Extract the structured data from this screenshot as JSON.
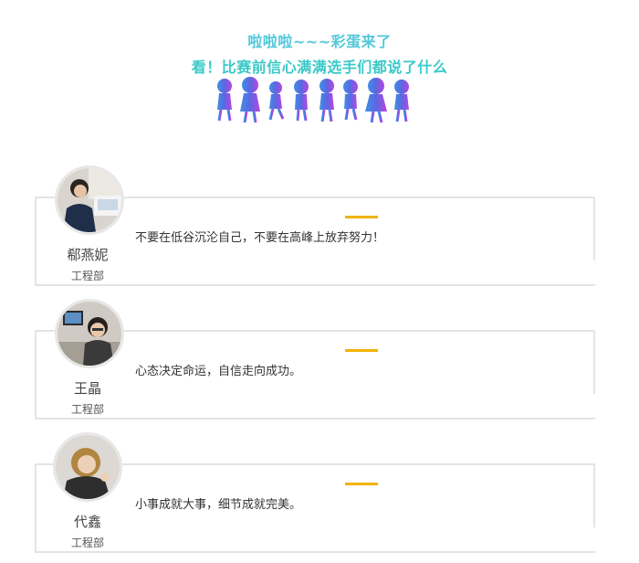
{
  "header": {
    "line1": "啦啦啦~~~彩蛋来了",
    "line2": "看！比赛前信心满满选手们都说了什么",
    "line1_color": "#53c7d9",
    "line2_color": "#3ac9c9",
    "decoration": "children-holding-hands-icon"
  },
  "accent_color": "#f0b400",
  "profiles": [
    {
      "name": "郗燕妮",
      "department": "工程部",
      "quote": "不要在低谷沉沦自己，不要在高峰上放弃努力！"
    },
    {
      "name": "王晶",
      "department": "工程部",
      "quote": "心态决定命运，自信走向成功。"
    },
    {
      "name": "代鑫",
      "department": "工程部",
      "quote": "小事成就大事，细节成就完美。"
    }
  ]
}
